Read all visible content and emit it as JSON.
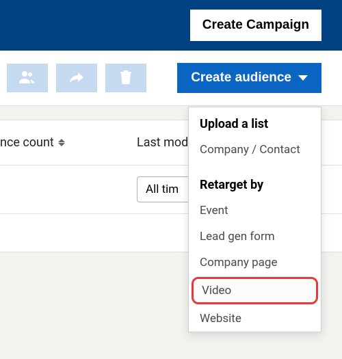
{
  "header": {
    "create_campaign_label": "Create Campaign"
  },
  "toolbar": {
    "create_audience_label": "Create audience"
  },
  "table": {
    "col_count_label": "nce count",
    "col_modified_label": "Last mod",
    "filter_value": "All tim"
  },
  "dropdown": {
    "section1_title": "Upload a list",
    "item_company_contact": "Company / Contact",
    "section2_title": "Retarget by",
    "item_event": "Event",
    "item_lead_gen": "Lead gen form",
    "item_company_page": "Company page",
    "item_video": "Video",
    "item_website": "Website"
  }
}
